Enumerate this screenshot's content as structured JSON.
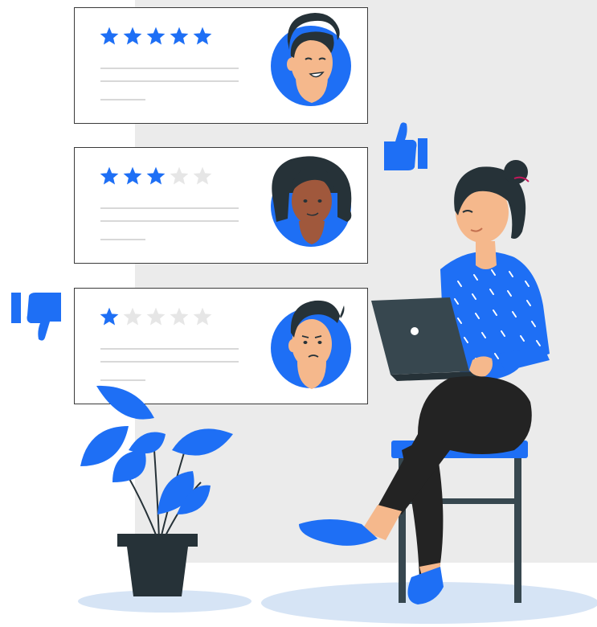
{
  "reviews": [
    {
      "rating": 5,
      "max": 5
    },
    {
      "rating": 3,
      "max": 5
    },
    {
      "rating": 1,
      "max": 5
    }
  ],
  "icons": {
    "like": "thumbs-up-icon",
    "dislike": "thumbs-down-icon",
    "star": "star-icon"
  },
  "colors": {
    "accent": "#1e6ff5",
    "star_empty": "#e6e6e6",
    "dark": "#263238",
    "skin": "#f5b88c",
    "skin_dark": "#a0583c",
    "pants": "#232323",
    "laptop": "#37474f",
    "shadow": "#d6e4f5"
  }
}
